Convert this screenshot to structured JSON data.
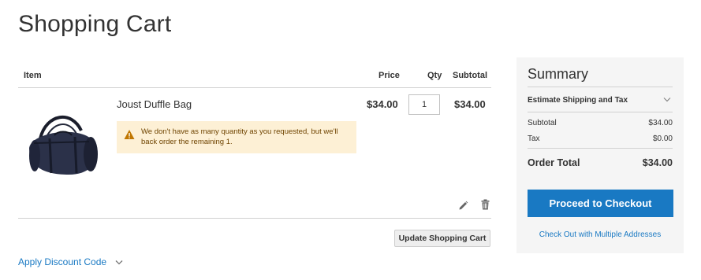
{
  "page": {
    "title": "Shopping Cart"
  },
  "cart": {
    "headers": {
      "item": "Item",
      "price": "Price",
      "qty": "Qty",
      "subtotal": "Subtotal"
    },
    "items": [
      {
        "name": "Joust Duffle Bag",
        "price": "$34.00",
        "qty": "1",
        "subtotal": "$34.00",
        "warning": "We don't have as many quantity as you requested, but we'll back order the remaining 1."
      }
    ],
    "update_label": "Update Shopping Cart",
    "discount_label": "Apply Discount Code"
  },
  "summary": {
    "title": "Summary",
    "estimate_label": "Estimate Shipping and Tax",
    "subtotal_label": "Subtotal",
    "subtotal_value": "$34.00",
    "tax_label": "Tax",
    "tax_value": "$0.00",
    "order_total_label": "Order Total",
    "order_total_value": "$34.00",
    "checkout_label": "Proceed to Checkout",
    "multi_address_label": "Check Out with Multiple Addresses"
  },
  "colors": {
    "accent": "#1979c3",
    "warning_bg": "#fdf0d5",
    "warning_icon": "#c07600",
    "summary_bg": "#f5f5f5"
  },
  "icons": {
    "warning": "warning-triangle-icon",
    "edit": "pencil-icon",
    "delete": "trash-icon",
    "expand": "chevron-down-icon"
  }
}
